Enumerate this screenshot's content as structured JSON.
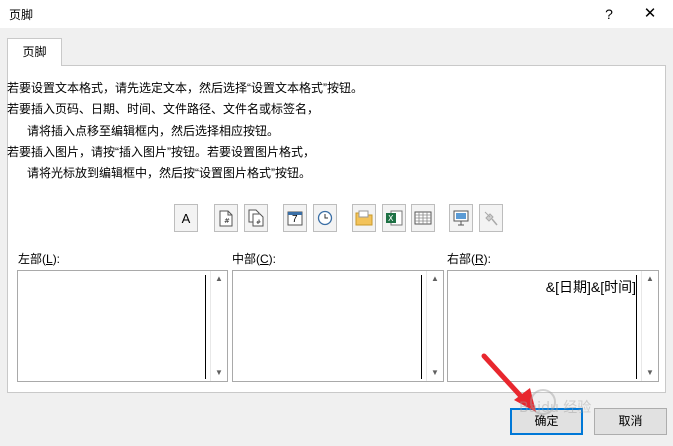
{
  "window": {
    "title": "页脚",
    "help_glyph": "?",
    "close_glyph": "✕"
  },
  "tab": {
    "label": "页脚"
  },
  "instructions": [
    "若要设置文本格式，请先选定文本，然后选择“设置文本格式”按钮。",
    "若要插入页码、日期、时间、文件路径、文件名或标签名，",
    "请将插入点移至编辑框内，然后选择相应按钮。",
    "若要插入图片，请按“插入图片”按钮。若要设置图片格式，",
    "请将光标放到编辑框中，然后按“设置图片格式”按钮。"
  ],
  "toolbar": {
    "format_text_glyph": "A",
    "date_glyph": "7",
    "icons": [
      "format-text-icon",
      "page-number-icon",
      "page-count-icon",
      "date-icon",
      "time-icon",
      "file-path-icon",
      "file-name-icon",
      "sheet-name-icon",
      "insert-picture-icon",
      "format-picture-icon"
    ]
  },
  "sections": {
    "left": {
      "label_pre": "左部(",
      "key": "L",
      "label_post": "):",
      "value": ""
    },
    "center": {
      "label_pre": "中部(",
      "key": "C",
      "label_post": "):",
      "value": ""
    },
    "right": {
      "label_pre": "右部(",
      "key": "R",
      "label_post": "):",
      "value": "&[日期]&[时间]"
    }
  },
  "buttons": {
    "ok": "确定",
    "cancel": "取消"
  },
  "watermark": {
    "text": "Baidu 经验"
  },
  "colors": {
    "accent": "#0078d7",
    "arrow": "#e8272e"
  }
}
